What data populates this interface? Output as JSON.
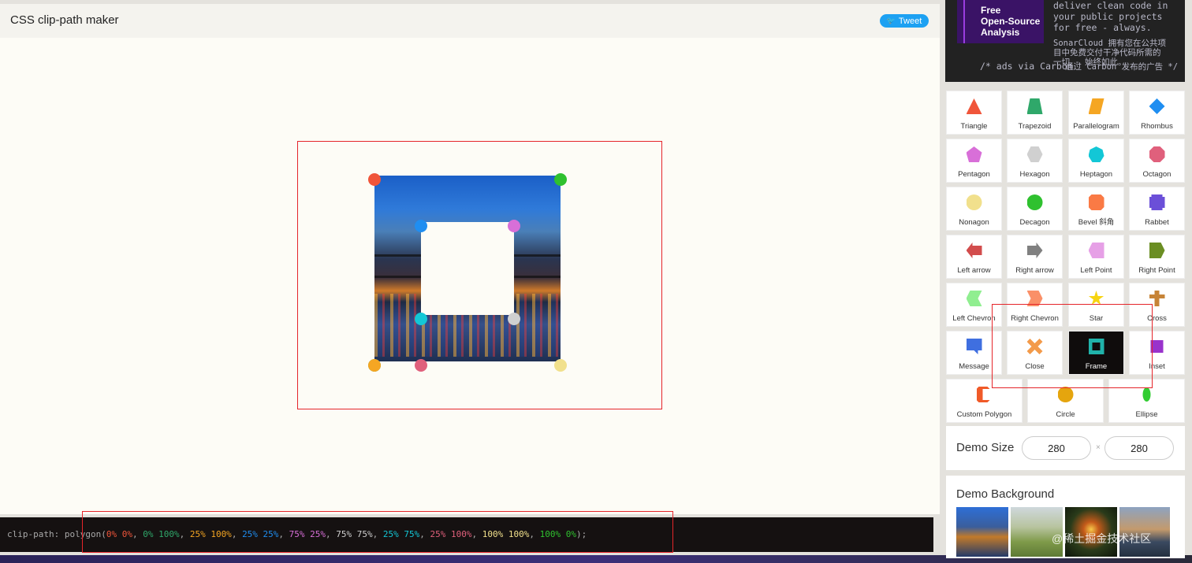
{
  "header": {
    "title": "CSS clip-path maker",
    "tweet_label": "Tweet"
  },
  "ad": {
    "logo_lines": [
      "Free",
      "Open-Source",
      "Analysis"
    ],
    "text_en": "deliver clean code in\nyour public projects\nfor free - always.",
    "text_zh": "SonarCloud 拥有您在公共项\n目中免费交付干净代码所需的\n一切 - 始终如此。",
    "via": "/* ads via Carbon",
    "via_zh": "通过 Carbon 发布的广告 */"
  },
  "shapes": [
    {
      "label": "Triangle",
      "color": "#f0553a",
      "icon": "triangle-icon"
    },
    {
      "label": "Trapezoid",
      "color": "#2fa86a",
      "icon": "trapezoid-icon"
    },
    {
      "label": "Parallelogram",
      "color": "#f5a623",
      "icon": "parallelogram-icon"
    },
    {
      "label": "Rhombus",
      "color": "#1f8ef1",
      "icon": "rhombus-icon"
    },
    {
      "label": "Pentagon",
      "color": "#d86fd8",
      "icon": "pentagon-icon"
    },
    {
      "label": "Hexagon",
      "color": "#d0d0d0",
      "icon": "hexagon-icon"
    },
    {
      "label": "Heptagon",
      "color": "#13c7d6",
      "icon": "heptagon-icon"
    },
    {
      "label": "Octagon",
      "color": "#e0607c",
      "icon": "octagon-icon"
    },
    {
      "label": "Nonagon",
      "color": "#f1e08c",
      "icon": "nonagon-icon"
    },
    {
      "label": "Decagon",
      "color": "#2fc12f",
      "icon": "decagon-icon"
    },
    {
      "label": "Bevel 斜角",
      "color": "#fa7a45",
      "icon": "bevel-icon"
    },
    {
      "label": "Rabbet",
      "color": "#6b4fd8",
      "icon": "rabbet-icon"
    },
    {
      "label": "Left arrow",
      "color": "#d24c4c",
      "icon": "left-arrow-icon"
    },
    {
      "label": "Right arrow",
      "color": "#808080",
      "icon": "right-arrow-icon"
    },
    {
      "label": "Left Point",
      "color": "#e6a0e6",
      "icon": "left-point-icon"
    },
    {
      "label": "Right Point",
      "color": "#6b8e23",
      "icon": "right-point-icon"
    },
    {
      "label": "Left Chevron",
      "color": "#90ee90",
      "icon": "left-chevron-icon"
    },
    {
      "label": "Right Chevron",
      "color": "#fa9068",
      "icon": "right-chevron-icon"
    },
    {
      "label": "Star",
      "color": "#f7d411",
      "icon": "star-icon"
    },
    {
      "label": "Cross",
      "color": "#c78437",
      "icon": "cross-icon"
    },
    {
      "label": "Message",
      "color": "#3f6fe0",
      "icon": "message-icon"
    },
    {
      "label": "Close",
      "color": "#f39a4a",
      "icon": "close-icon"
    },
    {
      "label": "Frame",
      "color": "#20b2aa",
      "icon": "frame-icon"
    },
    {
      "label": "Inset",
      "color": "#9932cc",
      "icon": "inset-icon"
    },
    {
      "label": "Custom Polygon",
      "color": "#f05a28",
      "icon": "custom-polygon-icon"
    },
    {
      "label": "Circle",
      "color": "#e5a50e",
      "icon": "circle-icon"
    },
    {
      "label": "Ellipse",
      "color": "#32cd32",
      "icon": "ellipse-icon"
    }
  ],
  "active_shape": "Frame",
  "demo_size": {
    "label": "Demo Size",
    "width": "280",
    "separator": "×",
    "height": "280"
  },
  "demo_background": {
    "label": "Demo Background"
  },
  "handles": [
    {
      "color": "#f0553a"
    },
    {
      "color": "#2fa86a"
    },
    {
      "color": "#f5a623"
    },
    {
      "color": "#1f8ef1"
    },
    {
      "color": "#d86fd8"
    },
    {
      "color": "#d0d0d0"
    },
    {
      "color": "#13c7d6"
    },
    {
      "color": "#e0607c"
    },
    {
      "color": "#f1e08c"
    },
    {
      "color": "#2fc12f"
    }
  ],
  "code": {
    "prefix": "clip-path: polygon(",
    "points": [
      {
        "text": "0% 0%",
        "color": "#f0553a"
      },
      {
        "text": "0% 100%",
        "color": "#2fa86a"
      },
      {
        "text": "25% 100%",
        "color": "#f5a623"
      },
      {
        "text": "25% 25%",
        "color": "#1f8ef1"
      },
      {
        "text": "75% 25%",
        "color": "#d86fd8"
      },
      {
        "text": "75% 75%",
        "color": "#d0d0d0"
      },
      {
        "text": "25% 75%",
        "color": "#13c7d6"
      },
      {
        "text": "25% 100%",
        "color": "#e0607c"
      },
      {
        "text": "100% 100%",
        "color": "#f1e08c"
      },
      {
        "text": "100% 0%",
        "color": "#2fc12f"
      }
    ],
    "suffix": ");"
  },
  "watermark": "@稀土掘金技术社区"
}
